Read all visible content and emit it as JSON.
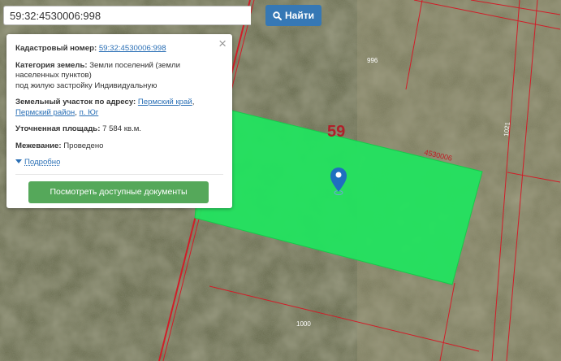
{
  "search": {
    "value": "59:32:4530006:998",
    "button_label": "Найти"
  },
  "info_card": {
    "cadastral_label": "Кадастровый номер:",
    "cadastral_value": "59:32:4530006:998",
    "category_label": "Категория земель:",
    "category_value": "Земли поселений (земли населенных пунктов)",
    "category_note": "под жилую застройку Индивидуальную",
    "address_label": "Земельный участок по адресу:",
    "address_link_1": "Пермский край",
    "address_link_2": "Пермский район",
    "address_link_3": "п. Юг",
    "area_label": "Уточненная площадь:",
    "area_value": "7 584 кв.м.",
    "survey_label": "Межевание:",
    "survey_value": "Проведено",
    "details_label": "Подробно",
    "docs_button_label": "Посмотреть доступные документы"
  },
  "map": {
    "region_label": "59",
    "quarter_label": "4530006",
    "parcel_labels": [
      "996",
      "1021",
      "1000"
    ],
    "parcel_fill": "#22e35f",
    "border_color": "#d11d28",
    "marker_color": "#1f6fbf"
  }
}
